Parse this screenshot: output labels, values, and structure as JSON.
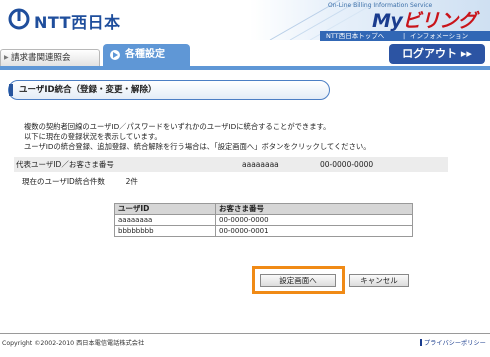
{
  "header": {
    "logo_text": "NTT西日本",
    "service_subtitle": "On-Line Billing Information Service",
    "service_title_prefix": "My",
    "service_title_suffix": "ビリング",
    "link_top": "NTT西日本トップへ",
    "link_info": "インフォメーション",
    "colors": {
      "brand_blue": "#1f4e9c",
      "brand_red": "#c9141b",
      "accent_orange": "#f08a16"
    }
  },
  "tabs": {
    "inactive": "請求書関連照会",
    "active": "各種設定",
    "logout": "ログアウト ▸▸"
  },
  "page": {
    "title": "ユーザID統合（登録・変更・解除）",
    "intro_lines": [
      "複数の契約者回線のユーザID／パスワードをいずれかのユーザIDに統合することができます。",
      "以下に現在の登録状況を表示しています。",
      "ユーザIDの統合登録、追加登録、統合解除を行う場合は、「設定画面へ」ボタンをクリックしてください。"
    ],
    "representative": {
      "label": "代表ユーザID／お客さま番号",
      "user_id": "aaaaaaaa",
      "customer_no": "00-0000-0000"
    },
    "count": {
      "label": "現在のユーザID統合件数",
      "value": "2件"
    },
    "table": {
      "headers": [
        "ユーザID",
        "お客さま番号"
      ],
      "rows": [
        [
          "aaaaaaaa",
          "00-0000-0000"
        ],
        [
          "bbbbbbbb",
          "00-0000-0001"
        ]
      ]
    },
    "buttons": {
      "setting": "設定画面へ",
      "cancel": "キャンセル"
    }
  },
  "footer": {
    "copyright": "Copyright ©2002-2010 西日本電信電話株式会社",
    "privacy": "プライバシーポリシー"
  }
}
